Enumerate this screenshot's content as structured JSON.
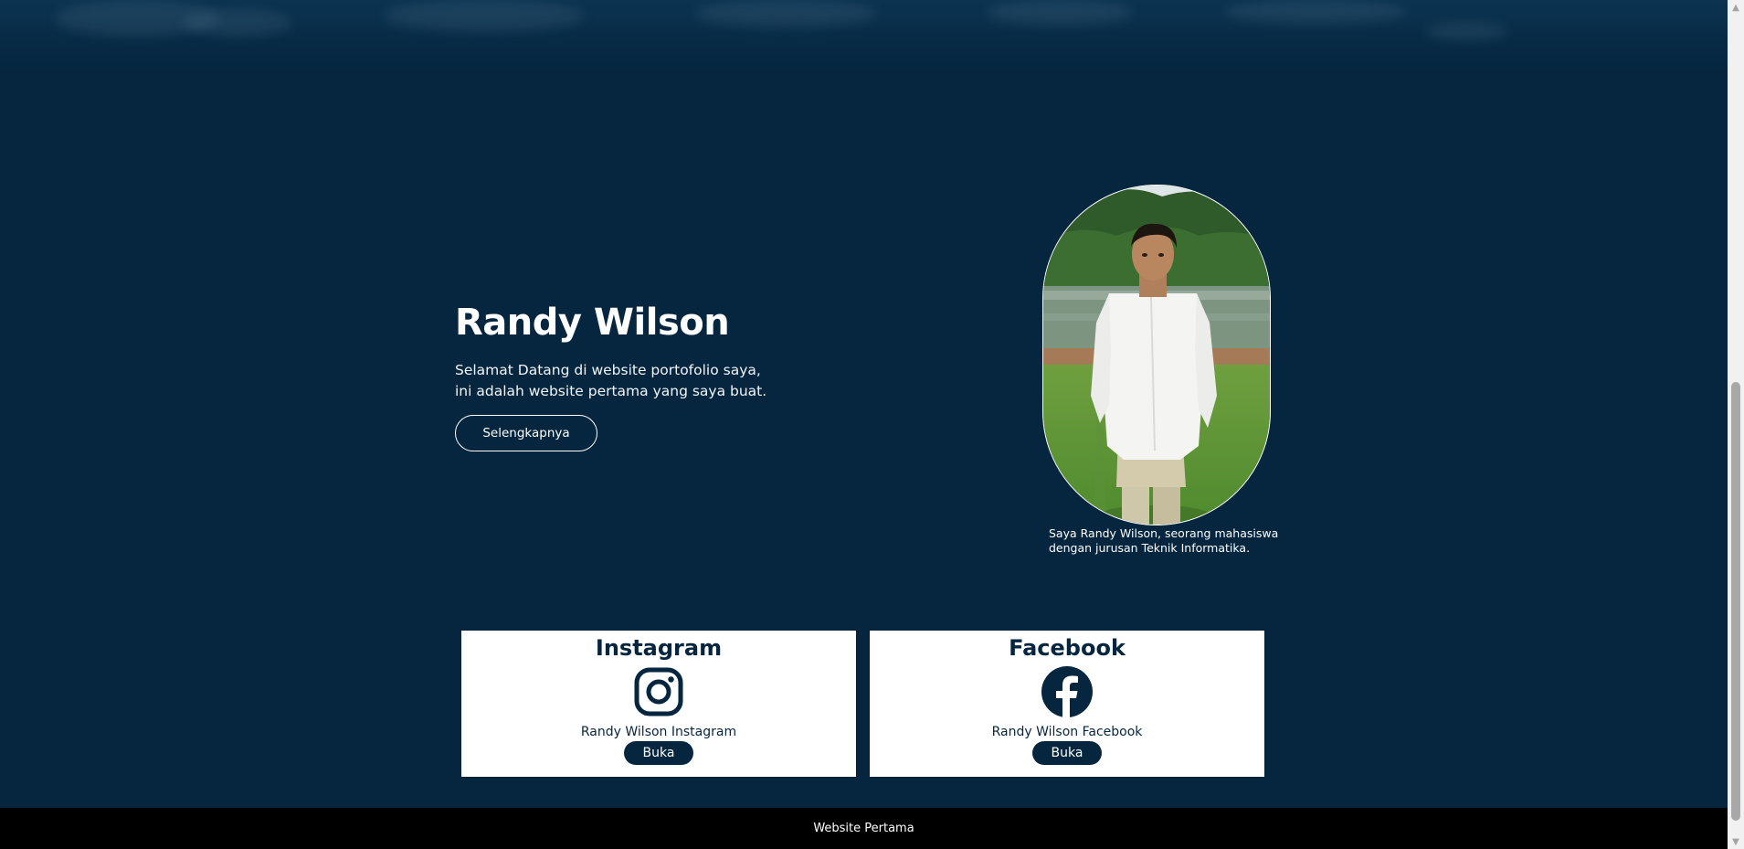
{
  "hero": {
    "title": "Randy Wilson",
    "subtitle_line1": "Selamat Datang di website portofolio saya,",
    "subtitle_line2": "ini adalah website pertama yang saya buat.",
    "button_label": "Selengkapnya"
  },
  "profile": {
    "caption_line1": "Saya Randy Wilson, seorang mahasiswa",
    "caption_line2": "dengan jurusan Teknik Informatika."
  },
  "social": [
    {
      "title": "Instagram",
      "label": "Randy Wilson Instagram",
      "button": "Buka",
      "icon": "instagram-icon"
    },
    {
      "title": "Facebook",
      "label": "Randy Wilson Facebook",
      "button": "Buka",
      "icon": "facebook-icon"
    }
  ],
  "footer": {
    "text": "Website Pertama"
  },
  "colors": {
    "background": "#06263f",
    "card": "#ffffff",
    "footer": "#000000",
    "accent": "#06263f"
  }
}
